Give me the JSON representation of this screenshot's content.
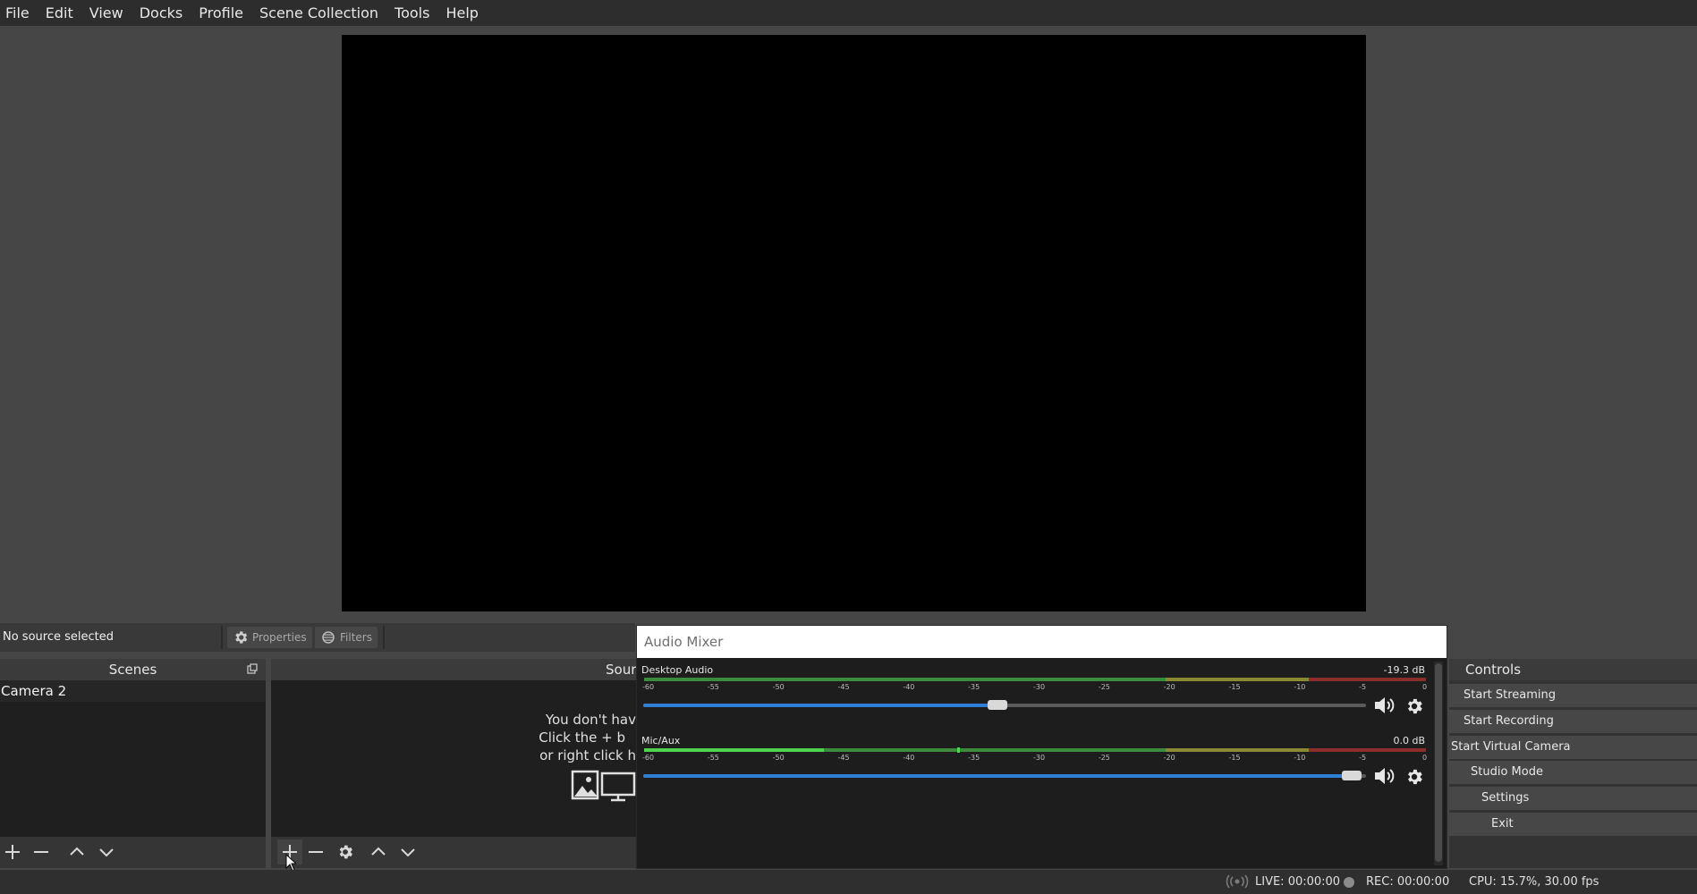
{
  "menu": [
    "File",
    "Edit",
    "View",
    "Docks",
    "Profile",
    "Scene Collection",
    "Tools",
    "Help"
  ],
  "source_toolbar": {
    "no_source": "No source selected",
    "properties_label": "Properties",
    "filters_label": "Filters"
  },
  "scenes": {
    "title": "Scenes",
    "items": [
      "Camera 2"
    ]
  },
  "sources": {
    "title_visible": "Sourc",
    "hint_line1": "You don't hav",
    "hint_line2": "Click the + b",
    "hint_line3": "or right click h"
  },
  "mixer": {
    "title": "Audio Mixer",
    "channels": [
      {
        "name": "Desktop Audio",
        "db": "-19.3 dB",
        "volume_fraction": 0.49,
        "meter_level_fraction": 0.0
      },
      {
        "name": "Mic/Aux",
        "db": "0.0 dB",
        "volume_fraction": 0.98,
        "meter_level_fraction": 0.23,
        "peak_fraction": 0.4
      }
    ],
    "scale": [
      "-60",
      "-55",
      "-50",
      "-45",
      "-40",
      "-35",
      "-30",
      "-25",
      "-20",
      "-15",
      "-10",
      "-5",
      "0"
    ]
  },
  "controls": {
    "title": "Controls",
    "buttons": [
      "Start Streaming",
      "Start Recording",
      "Start Virtual Camera",
      "Studio Mode",
      "Settings",
      "Exit"
    ]
  },
  "status": {
    "live": "LIVE: 00:00:00",
    "rec": "REC: 00:00:00",
    "cpu": "CPU: 15.7%, 30.00 fps"
  },
  "colors": {
    "accent_blue": "#2f7fd6",
    "meter_green": "#3c8a3c",
    "meter_green_active": "#4fd44f",
    "meter_yellow": "#8a8a34",
    "meter_red": "#8b2d2d"
  },
  "icons": {
    "add": "plus-icon",
    "remove": "minus-icon",
    "up": "chevron-up-icon",
    "down": "chevron-down-icon",
    "gear": "gear-icon",
    "speaker": "speaker-icon",
    "image": "image-icon",
    "display": "monitor-icon"
  }
}
